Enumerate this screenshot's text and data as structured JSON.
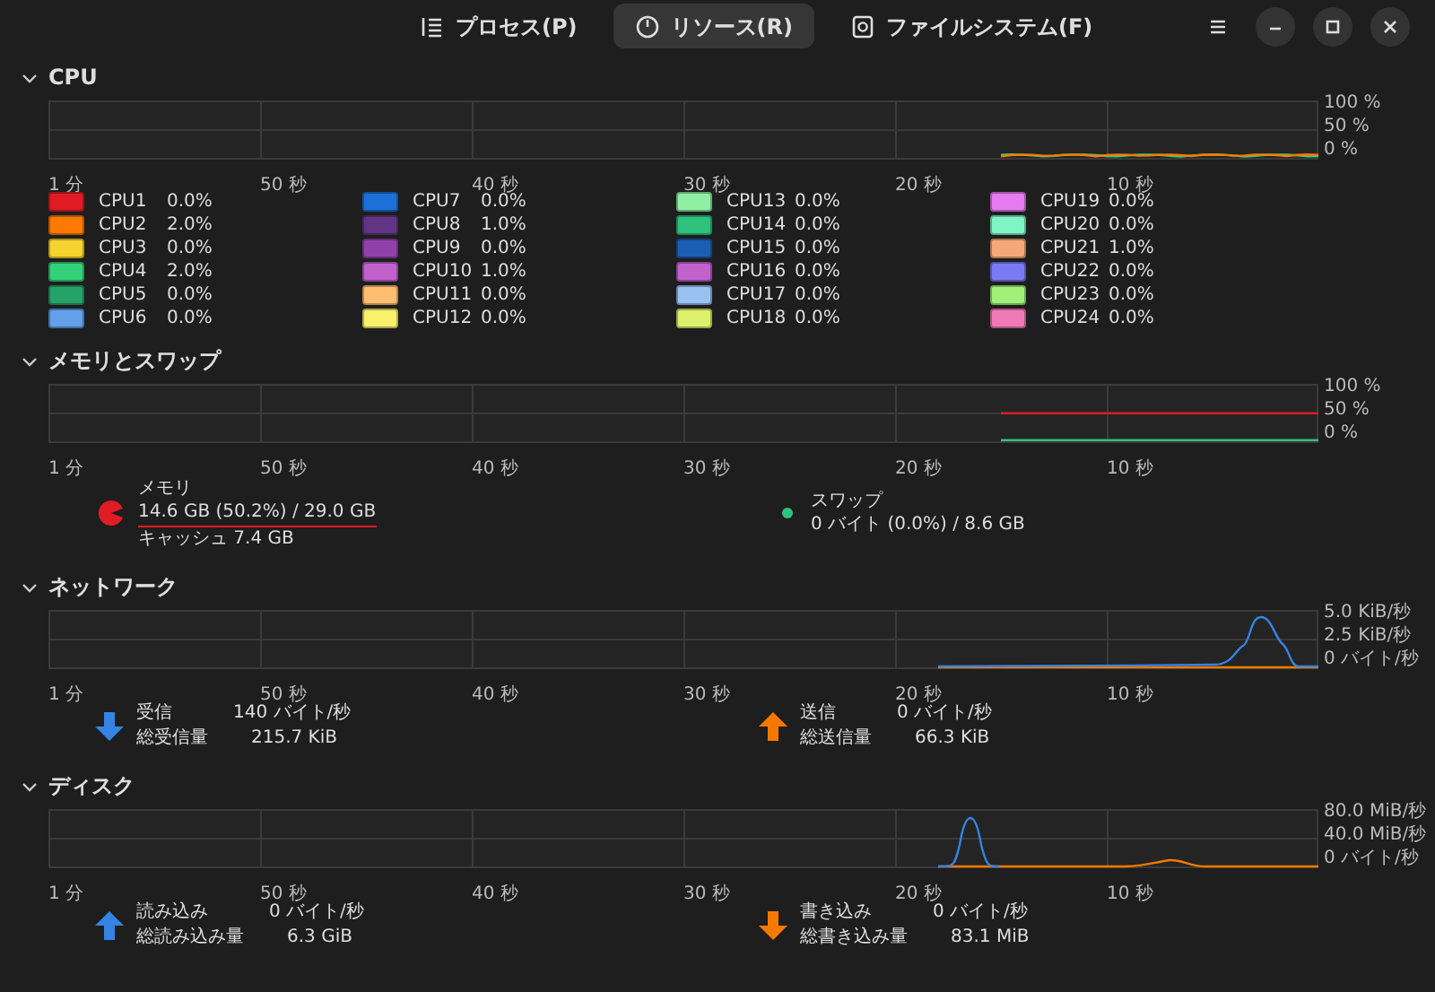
{
  "tabs": [
    {
      "label": "プロセス(P)",
      "selected": false
    },
    {
      "label": "リソース(R)",
      "selected": true
    },
    {
      "label": "ファイルシステム(F)",
      "selected": false
    }
  ],
  "sections": [
    {
      "kind": "cpu",
      "title": "CPU",
      "expanded": true,
      "graph": {
        "x_labels": [
          "1 分",
          "50 秒",
          "40 秒",
          "30 秒",
          "20 秒",
          "10 秒"
        ],
        "y_labels": [
          "100 %",
          "50 %",
          "0 %"
        ]
      },
      "cpus": [
        {
          "name": "CPU1",
          "value": "0.0%",
          "color": "#e01b24"
        },
        {
          "name": "CPU2",
          "value": "2.0%",
          "color": "#ff7800"
        },
        {
          "name": "CPU3",
          "value": "0.0%",
          "color": "#f6d32d"
        },
        {
          "name": "CPU4",
          "value": "2.0%",
          "color": "#33d17a"
        },
        {
          "name": "CPU5",
          "value": "0.0%",
          "color": "#26a269"
        },
        {
          "name": "CPU6",
          "value": "0.0%",
          "color": "#62a0ea"
        },
        {
          "name": "CPU7",
          "value": "0.0%",
          "color": "#1c71d8"
        },
        {
          "name": "CPU8",
          "value": "1.0%",
          "color": "#613583"
        },
        {
          "name": "CPU9",
          "value": "0.0%",
          "color": "#9141ac"
        },
        {
          "name": "CPU10",
          "value": "1.0%",
          "color": "#c061cb"
        },
        {
          "name": "CPU11",
          "value": "0.0%",
          "color": "#ffbe6f"
        },
        {
          "name": "CPU12",
          "value": "0.0%",
          "color": "#f9f06b"
        },
        {
          "name": "CPU13",
          "value": "0.0%",
          "color": "#8ff0a4"
        },
        {
          "name": "CPU14",
          "value": "0.0%",
          "color": "#2ec27e"
        },
        {
          "name": "CPU15",
          "value": "0.0%",
          "color": "#1a5fb4"
        },
        {
          "name": "CPU16",
          "value": "0.0%",
          "color": "#c061cc"
        },
        {
          "name": "CPU17",
          "value": "0.0%",
          "color": "#99c1f1"
        },
        {
          "name": "CPU18",
          "value": "0.0%",
          "color": "#dcf06b"
        },
        {
          "name": "CPU19",
          "value": "0.0%",
          "color": "#e77bf0"
        },
        {
          "name": "CPU20",
          "value": "0.0%",
          "color": "#7ff5c4"
        },
        {
          "name": "CPU21",
          "value": "1.0%",
          "color": "#f5a87a"
        },
        {
          "name": "CPU22",
          "value": "0.0%",
          "color": "#7a7af5"
        },
        {
          "name": "CPU23",
          "value": "0.0%",
          "color": "#a0f07a"
        },
        {
          "name": "CPU24",
          "value": "0.0%",
          "color": "#f07ab8"
        }
      ]
    },
    {
      "kind": "memory",
      "title": "メモリとスワップ",
      "expanded": true,
      "graph": {
        "x_labels": [
          "1 分",
          "50 秒",
          "40 秒",
          "30 秒",
          "20 秒",
          "10 秒"
        ],
        "y_labels": [
          "100 %",
          "50 %",
          "0 %"
        ]
      },
      "memory": {
        "label": "メモリ",
        "usage": "14.6 GB (50.2%) / 29.0 GB",
        "cache": "キャッシュ 7.4 GB",
        "color": "#e01b24"
      },
      "swap": {
        "label": "スワップ",
        "usage": "0 バイト (0.0%) / 8.6 GB",
        "color": "#2ec27e"
      }
    },
    {
      "kind": "network",
      "title": "ネットワーク",
      "expanded": true,
      "graph": {
        "x_labels": [
          "1 分",
          "50 秒",
          "40 秒",
          "30 秒",
          "20 秒",
          "10 秒"
        ],
        "y_labels": [
          "5.0 KiB/秒",
          "2.5 KiB/秒",
          "0 バイト/秒"
        ]
      },
      "stats": [
        {
          "kind": "down",
          "color": "#3584e4",
          "label": "受信",
          "value": "140 バイト/秒",
          "total_label": "総受信量",
          "total": "215.7 KiB"
        },
        {
          "kind": "up",
          "color": "#f57900",
          "label": "送信",
          "value": "0 バイト/秒",
          "total_label": "総送信量",
          "total": "66.3 KiB"
        }
      ]
    },
    {
      "kind": "disk",
      "title": "ディスク",
      "expanded": true,
      "graph": {
        "x_labels": [
          "1 分",
          "50 秒",
          "40 秒",
          "30 秒",
          "20 秒",
          "10 秒"
        ],
        "y_labels": [
          "80.0 MiB/秒",
          "40.0 MiB/秒",
          "0 バイト/秒"
        ]
      },
      "stats": [
        {
          "kind": "up",
          "color": "#3584e4",
          "label": "読み込み",
          "value": "0 バイト/秒",
          "total_label": "総読み込み量",
          "total": "6.3 GiB"
        },
        {
          "kind": "down",
          "color": "#f57900",
          "label": "書き込み",
          "value": "0 バイト/秒",
          "total_label": "総書き込み量",
          "total": "83.1 MiB"
        }
      ]
    }
  ]
}
